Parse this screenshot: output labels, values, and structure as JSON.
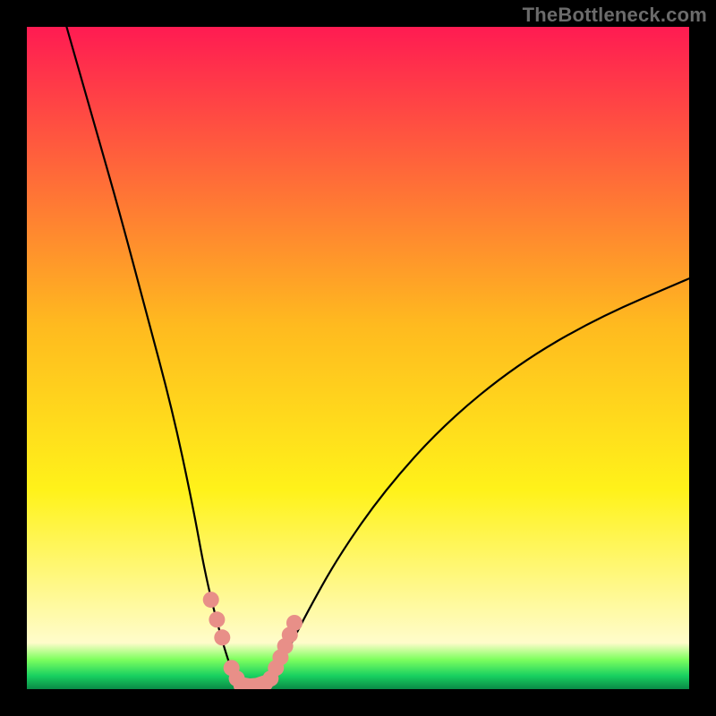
{
  "watermark": "TheBottleneck.com",
  "chart_data": {
    "type": "line",
    "title": "",
    "xlabel": "",
    "ylabel": "",
    "ylim": [
      0,
      100
    ],
    "xlim": [
      0,
      100
    ],
    "gradient_stops": [
      {
        "offset": 0,
        "color": "#ff1b52"
      },
      {
        "offset": 0.45,
        "color": "#ffba1f"
      },
      {
        "offset": 0.7,
        "color": "#fff21a"
      },
      {
        "offset": 0.93,
        "color": "#fffccb"
      },
      {
        "offset": 0.955,
        "color": "#7fff5f"
      },
      {
        "offset": 0.98,
        "color": "#18d060"
      },
      {
        "offset": 1.0,
        "color": "#0a8a46"
      }
    ],
    "series": [
      {
        "name": "left-branch",
        "x": [
          6,
          10,
          14,
          18,
          22,
          25,
          27,
          29,
          30.5,
          31.5
        ],
        "y": [
          100,
          86,
          72,
          57,
          42,
          28,
          17,
          9,
          4,
          1.5
        ]
      },
      {
        "name": "right-branch",
        "x": [
          37,
          39,
          42,
          47,
          54,
          63,
          74,
          86,
          100
        ],
        "y": [
          1.5,
          5,
          11,
          20,
          30,
          40,
          49,
          56,
          62
        ]
      },
      {
        "name": "trough",
        "x": [
          31.5,
          32.5,
          34,
          35.5,
          37
        ],
        "y": [
          1.5,
          0.6,
          0.3,
          0.6,
          1.5
        ]
      }
    ],
    "marker_points": {
      "left": [
        {
          "x": 27.8,
          "y": 13.5
        },
        {
          "x": 28.7,
          "y": 10.5
        },
        {
          "x": 29.5,
          "y": 7.8
        },
        {
          "x": 30.9,
          "y": 3.2
        },
        {
          "x": 31.7,
          "y": 1.6
        }
      ],
      "right": [
        {
          "x": 36.8,
          "y": 1.6
        },
        {
          "x": 37.6,
          "y": 3.2
        },
        {
          "x": 38.3,
          "y": 4.8
        },
        {
          "x": 39.0,
          "y": 6.5
        },
        {
          "x": 39.7,
          "y": 8.2
        },
        {
          "x": 40.4,
          "y": 10.0
        }
      ],
      "green_bottom": [
        {
          "x": 32.4,
          "y": 0.6
        },
        {
          "x": 33.6,
          "y": 0.4
        },
        {
          "x": 34.8,
          "y": 0.5
        },
        {
          "x": 36.0,
          "y": 0.9
        }
      ]
    },
    "marker_style": {
      "radius_px": 9,
      "fill": "#e88f88"
    }
  }
}
